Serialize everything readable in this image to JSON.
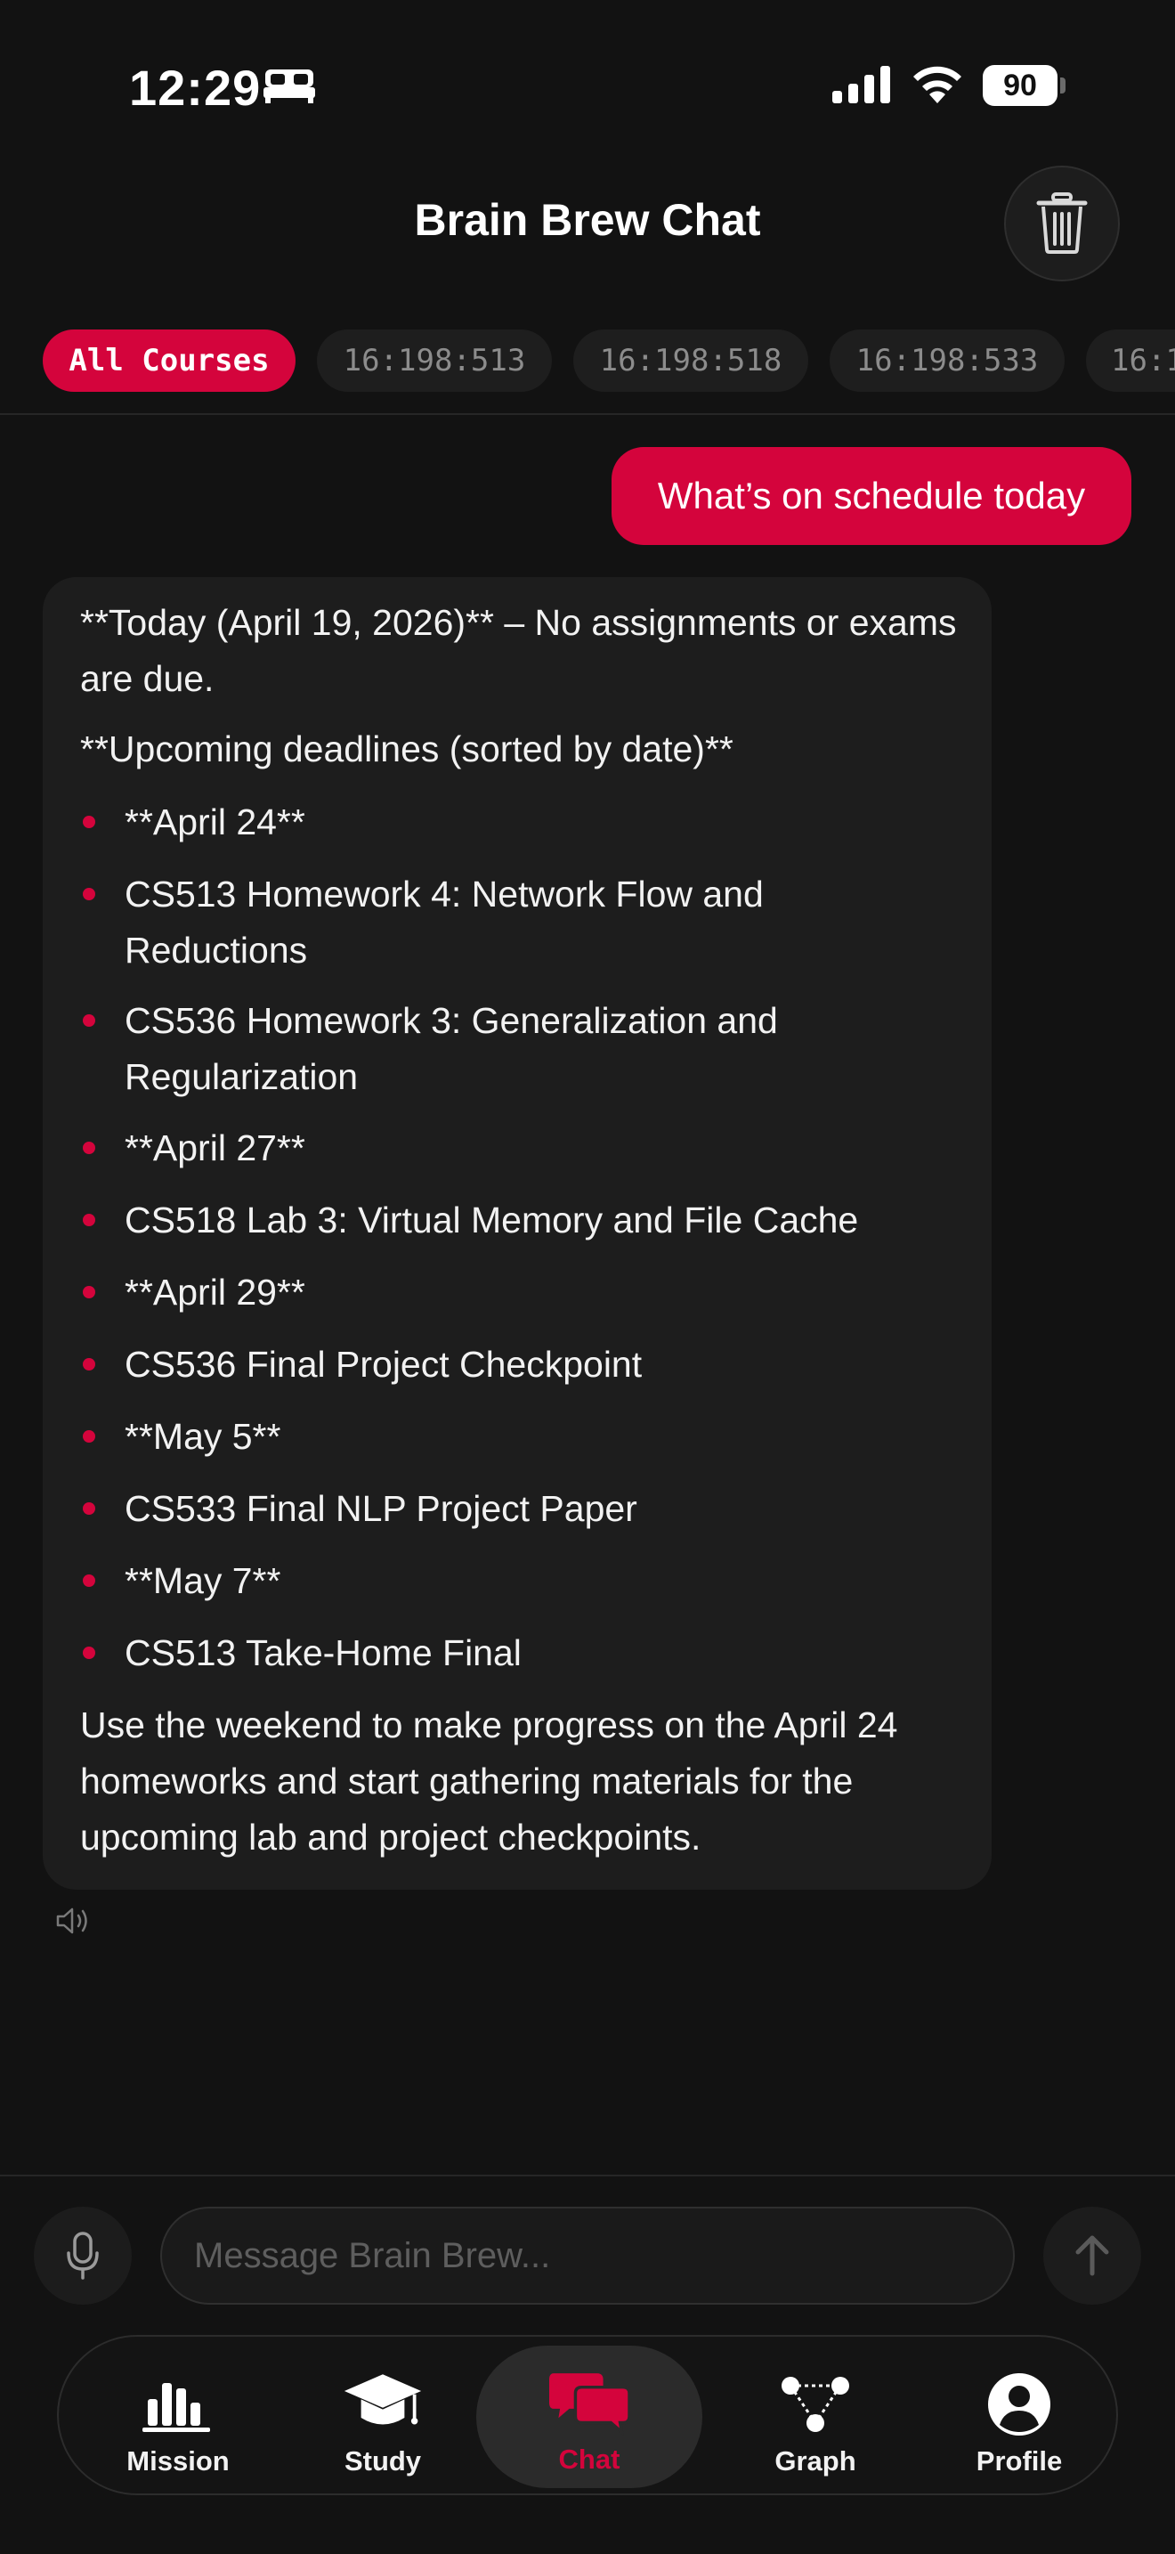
{
  "status_bar": {
    "time": "12:29",
    "battery": "90"
  },
  "header": {
    "title": "Brain Brew Chat"
  },
  "chips": [
    {
      "label": "All Courses",
      "active": true
    },
    {
      "label": "16:198:513",
      "active": false
    },
    {
      "label": "16:198:518",
      "active": false
    },
    {
      "label": "16:198:533",
      "active": false
    },
    {
      "label": "16:1",
      "active": false
    }
  ],
  "user_message": "What’s on schedule today",
  "bot_message": {
    "intro": "**Today (April 19, 2026)** – No assignments or exams are due.",
    "upcoming_heading": "**Upcoming deadlines (sorted by date)**",
    "bullets": [
      "**April 24**",
      "CS513 Homework 4: Network Flow and Reductions",
      "CS536 Homework 3: Generalization and Regularization",
      "**April 27**",
      "CS518 Lab 3: Virtual Memory and File Cache",
      "**April 29**",
      "CS536 Final Project Checkpoint",
      "**May 5**",
      "CS533 Final NLP Project Paper",
      "**May 7**",
      "CS513 Take-Home Final"
    ],
    "closing": "Use the weekend to make progress on the April 24 homeworks and start gathering materials for the upcoming lab and project checkpoints."
  },
  "composer": {
    "placeholder": "Message Brain Brew..."
  },
  "tabs": [
    {
      "label": "Mission",
      "icon": "bar-chart-icon",
      "active": false
    },
    {
      "label": "Study",
      "icon": "graduation-cap-icon",
      "active": false
    },
    {
      "label": "Chat",
      "icon": "chat-bubbles-icon",
      "active": true
    },
    {
      "label": "Graph",
      "icon": "graph-nodes-icon",
      "active": false
    },
    {
      "label": "Profile",
      "icon": "profile-icon",
      "active": false
    }
  ],
  "colors": {
    "accent": "#d4043c",
    "background": "#121212",
    "bubble": "#1d1d1d"
  }
}
